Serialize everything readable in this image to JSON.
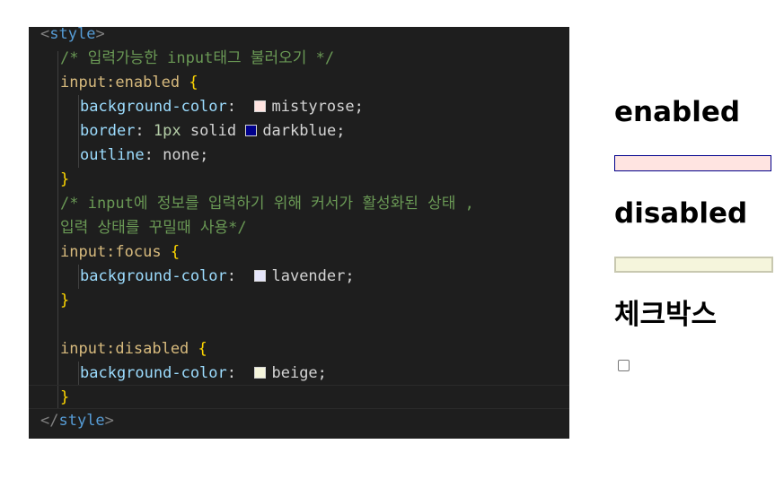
{
  "code": {
    "open_tag": "style",
    "close_tag": "style",
    "comment1": "/* 입력가능한 input태그 불러오기 */",
    "sel_enabled": "input:enabled",
    "prop_bg": "background-color",
    "val_mistyrose": "mistyrose;",
    "prop_border": "border",
    "val_border_px": "1px",
    "val_border_solid": "solid",
    "val_darkblue": "darkblue;",
    "prop_outline": "outline",
    "val_none": "none;",
    "comment2_a": "/* input에 정보를 입력하기 위해 커서가 활성화된 상태 ,",
    "comment2_b": "입력 상태를 꾸밀때 사용*/",
    "sel_focus": "input:focus",
    "val_lavender": "lavender;",
    "sel_disabled": "input:disabled",
    "val_beige": "beige;",
    "colors": {
      "mistyrose": "#ffe4e1",
      "darkblue": "#00008b",
      "lavender": "#e6e6fa",
      "beige": "#f5f5dc"
    }
  },
  "preview": {
    "heading_enabled": "enabled",
    "heading_disabled": "disabled",
    "heading_checkbox": "체크박스"
  }
}
